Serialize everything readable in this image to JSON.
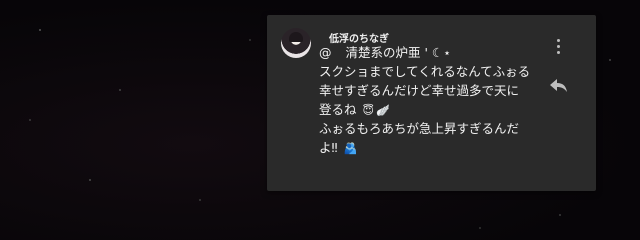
{
  "post": {
    "username": "低浮のちなぎ",
    "mention_at": "@",
    "mention_name": "清楚系の炉亜 ' ☾⋆",
    "lines": [
      "スクショまでしてくれるなんてふぉる",
      "幸せすぎるんだけど幸せ過多で天に",
      "登るね",
      "ふぉるもろあちが急上昇すぎるんだ",
      "よ‼"
    ],
    "emoji_halo": "😇",
    "emoji_wings": "🪽",
    "emoji_hug": "🫂"
  },
  "icons": {
    "menu": "more-vert-icon",
    "reply": "reply-icon"
  },
  "colors": {
    "card_bg": "#2a2a2a",
    "text": "#f2f2f2",
    "icon": "#bdbdbd",
    "background": "#070508"
  }
}
